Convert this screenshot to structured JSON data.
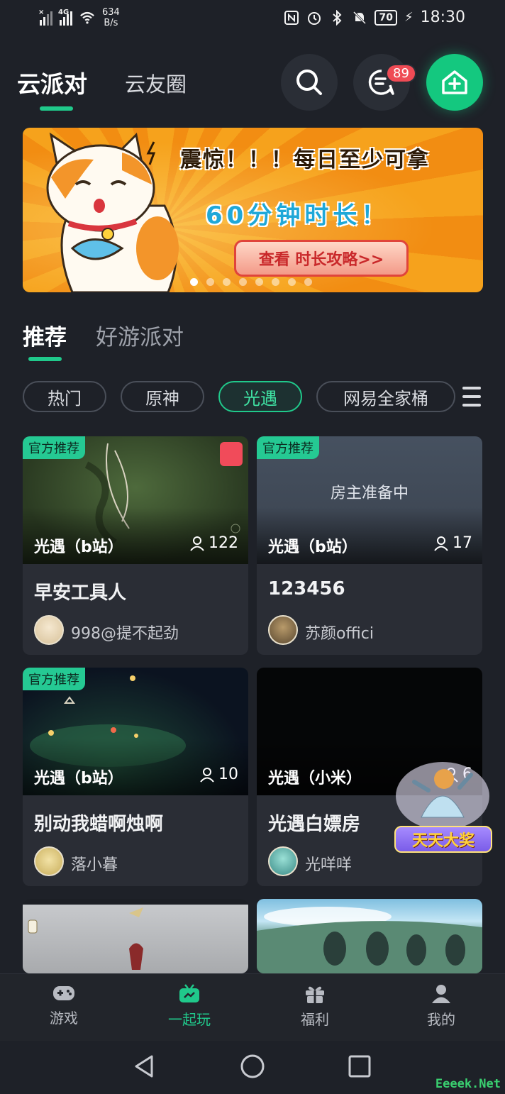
{
  "status_bar": {
    "network_small": "×",
    "network_type": "4G",
    "speed_value": "634",
    "speed_unit": "B/s",
    "battery": "70",
    "time": "18:30"
  },
  "header": {
    "tab_active": "云派对",
    "tab_other": "云友圈",
    "message_badge": "89"
  },
  "banner": {
    "headline": "震惊！！！每日至少可拿",
    "subline": "60分钟时长！",
    "cta": "查看 时长攻略>>",
    "dot_count": 8,
    "active_dot": 0
  },
  "section_tabs": {
    "active": "推荐",
    "other": "好游派对"
  },
  "chips": [
    "热门",
    "原神",
    "光遇",
    "网易全家桶"
  ],
  "active_chip": "光遇",
  "cards": [
    {
      "tag": "官方推荐",
      "game": "光遇（b站）",
      "players": "122",
      "title": "早安工具人",
      "user": "998@提不起劲",
      "status": ""
    },
    {
      "tag": "官方推荐",
      "game": "光遇（b站）",
      "players": "17",
      "title": "123456",
      "user": "苏颜offici",
      "status": "房主准备中"
    },
    {
      "tag": "官方推荐",
      "game": "光遇（b站）",
      "players": "10",
      "title": "别动我蜡啊烛啊",
      "user": "落小暮",
      "status": ""
    },
    {
      "tag": "",
      "game": "光遇（小米）",
      "players": "6",
      "title": "光遇白嫖房",
      "user": "光咩咩",
      "status": ""
    }
  ],
  "floating_prize": "天天大奖",
  "bottom_nav": [
    "游戏",
    "一起玩",
    "福利",
    "我的"
  ],
  "bottom_nav_active": "一起玩",
  "watermark": "Eeeek.Net",
  "colors": {
    "accent": "#20c98b",
    "background": "#1e2128",
    "card": "#2a2d35",
    "badge": "#ef4b55"
  }
}
